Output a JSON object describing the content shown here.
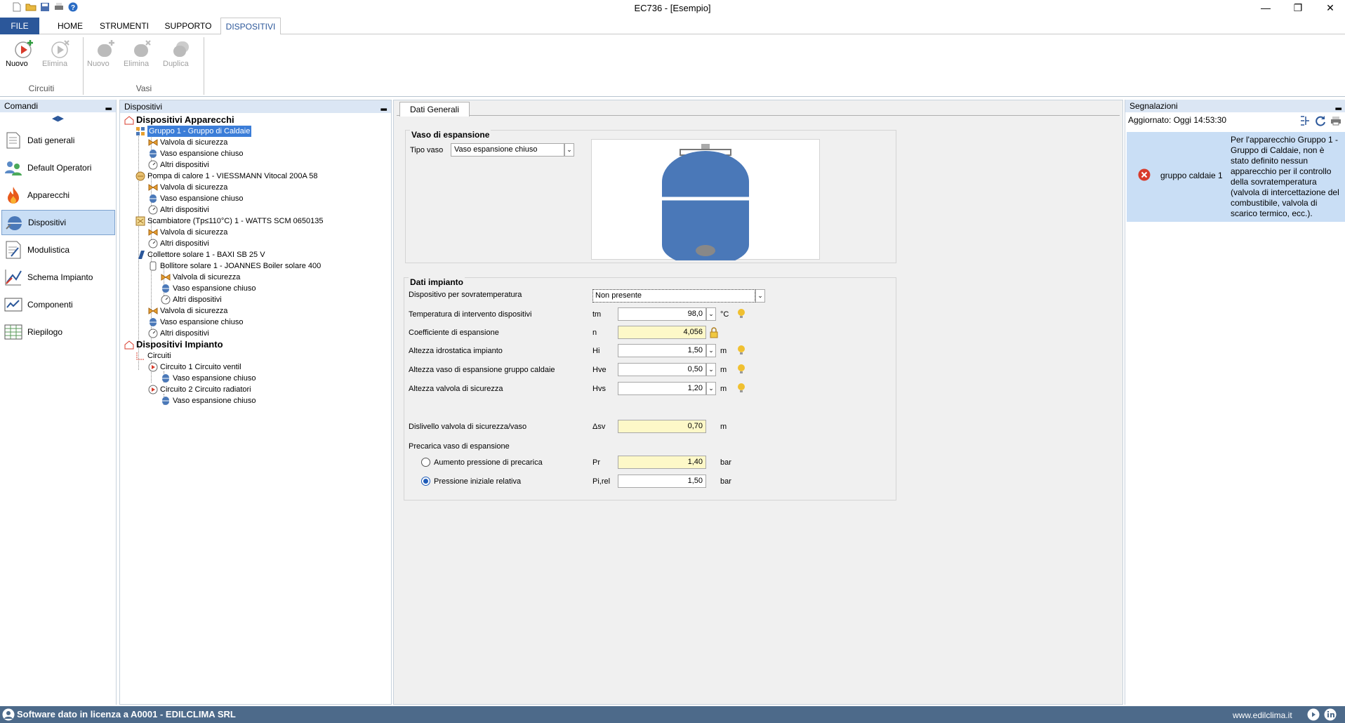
{
  "window": {
    "title": "EC736 - [Esempio]"
  },
  "ribbon": {
    "tabs": [
      "FILE",
      "HOME",
      "STRUMENTI",
      "SUPPORTO",
      "DISPOSITIVI"
    ],
    "groups": {
      "circuiti": {
        "label": "Circuiti",
        "buttons": [
          "Nuovo",
          "Elimina"
        ]
      },
      "vasi": {
        "label": "Vasi",
        "buttons": [
          "Nuovo",
          "Elimina",
          "Duplica"
        ]
      }
    }
  },
  "comandi": {
    "title": "Comandi",
    "items": [
      "Dati generali",
      "Default Operatori",
      "Apparecchi",
      "Dispositivi",
      "Modulistica",
      "Schema Impianto",
      "Componenti",
      "Riepilogo"
    ],
    "selected": "Dispositivi"
  },
  "tree": {
    "title": "Dispositivi",
    "nodes": [
      "Dispositivi Apparecchi",
      "Gruppo 1 - Gruppo di Caldaie",
      "Valvola di sicurezza",
      "Vaso espansione chiuso",
      "Altri dispositivi",
      "Pompa di calore 1 - VIESSMANN Vitocal 200A 58",
      "Valvola di sicurezza",
      "Vaso espansione chiuso",
      "Altri dispositivi",
      "Scambiatore (Tp≤110°C) 1 - WATTS  SCM 0650135",
      "Valvola di sicurezza",
      "Altri dispositivi",
      "Collettore solare 1 - BAXI SB 25 V",
      "Bollitore solare 1 - JOANNES Boiler solare 400",
      "Valvola di sicurezza",
      "Vaso espansione chiuso",
      "Altri dispositivi",
      "Valvola di sicurezza",
      "Vaso espansione chiuso",
      "Altri dispositivi",
      "Dispositivi Impianto",
      "Circuiti",
      "Circuito 1 Circuito ventil",
      "Vaso espansione chiuso",
      "Circuito 2 Circuito radiatori",
      "Vaso espansione chiuso"
    ]
  },
  "main": {
    "tab": "Dati Generali",
    "vaso": {
      "legend": "Vaso di espansione",
      "tipo_label": "Tipo vaso",
      "tipo_value": "Vaso espansione chiuso"
    },
    "impianto": {
      "legend": "Dati impianto",
      "sovra_label": "Dispositivo per sovratemperatura",
      "sovra_value": "Non presente",
      "rows": [
        {
          "label": "Temperatura di intervento dispositivi",
          "sym": "tm",
          "value": "98,0",
          "unit": "°C"
        },
        {
          "label": "Coefficiente di espansione",
          "sym": "n",
          "value": "4,056",
          "unit": ""
        },
        {
          "label": "Altezza idrostatica impianto",
          "sym": "Hi",
          "value": "1,50",
          "unit": "m"
        },
        {
          "label": "Altezza vaso di espansione gruppo caldaie",
          "sym": "Hve",
          "value": "0,50",
          "unit": "m"
        },
        {
          "label": "Altezza valvola di sicurezza",
          "sym": "Hvs",
          "value": "1,20",
          "unit": "m"
        },
        {
          "label": "Dislivello valvola di sicurezza/vaso",
          "sym": "Δsv",
          "value": "0,70",
          "unit": "m"
        }
      ],
      "precarica_label": "Precarica vaso di espansione",
      "pre_rows": [
        {
          "label": "Aumento pressione di precarica",
          "sym": "Pr",
          "value": "1,40",
          "unit": "bar",
          "checked": false
        },
        {
          "label": "Pressione iniziale relativa",
          "sym": "Pi,rel",
          "value": "1,50",
          "unit": "bar",
          "checked": true
        }
      ]
    }
  },
  "segnalazioni": {
    "title": "Segnalazioni",
    "updated": "Aggiornato:  Oggi 14:53:30",
    "items": [
      {
        "source": "gruppo caldaie 1",
        "message": "Per l'apparecchio Gruppo 1 - Gruppo di Caldaie, non è stato definito nessun apparecchio per il controllo della sovratemperatura (valvola di intercettazione del combustibile, valvola di scarico termico, ecc.)."
      }
    ]
  },
  "status": {
    "license": "Software dato in licenza a A0001 - EDILCLIMA SRL",
    "site": "www.edilclima.it"
  },
  "colors": {
    "accent": "#2b579a",
    "selection": "#3b7dd8",
    "statusbar": "#4d6a8a",
    "highlight_input": "#fdf8c8",
    "alert_bg": "#c9def5"
  }
}
